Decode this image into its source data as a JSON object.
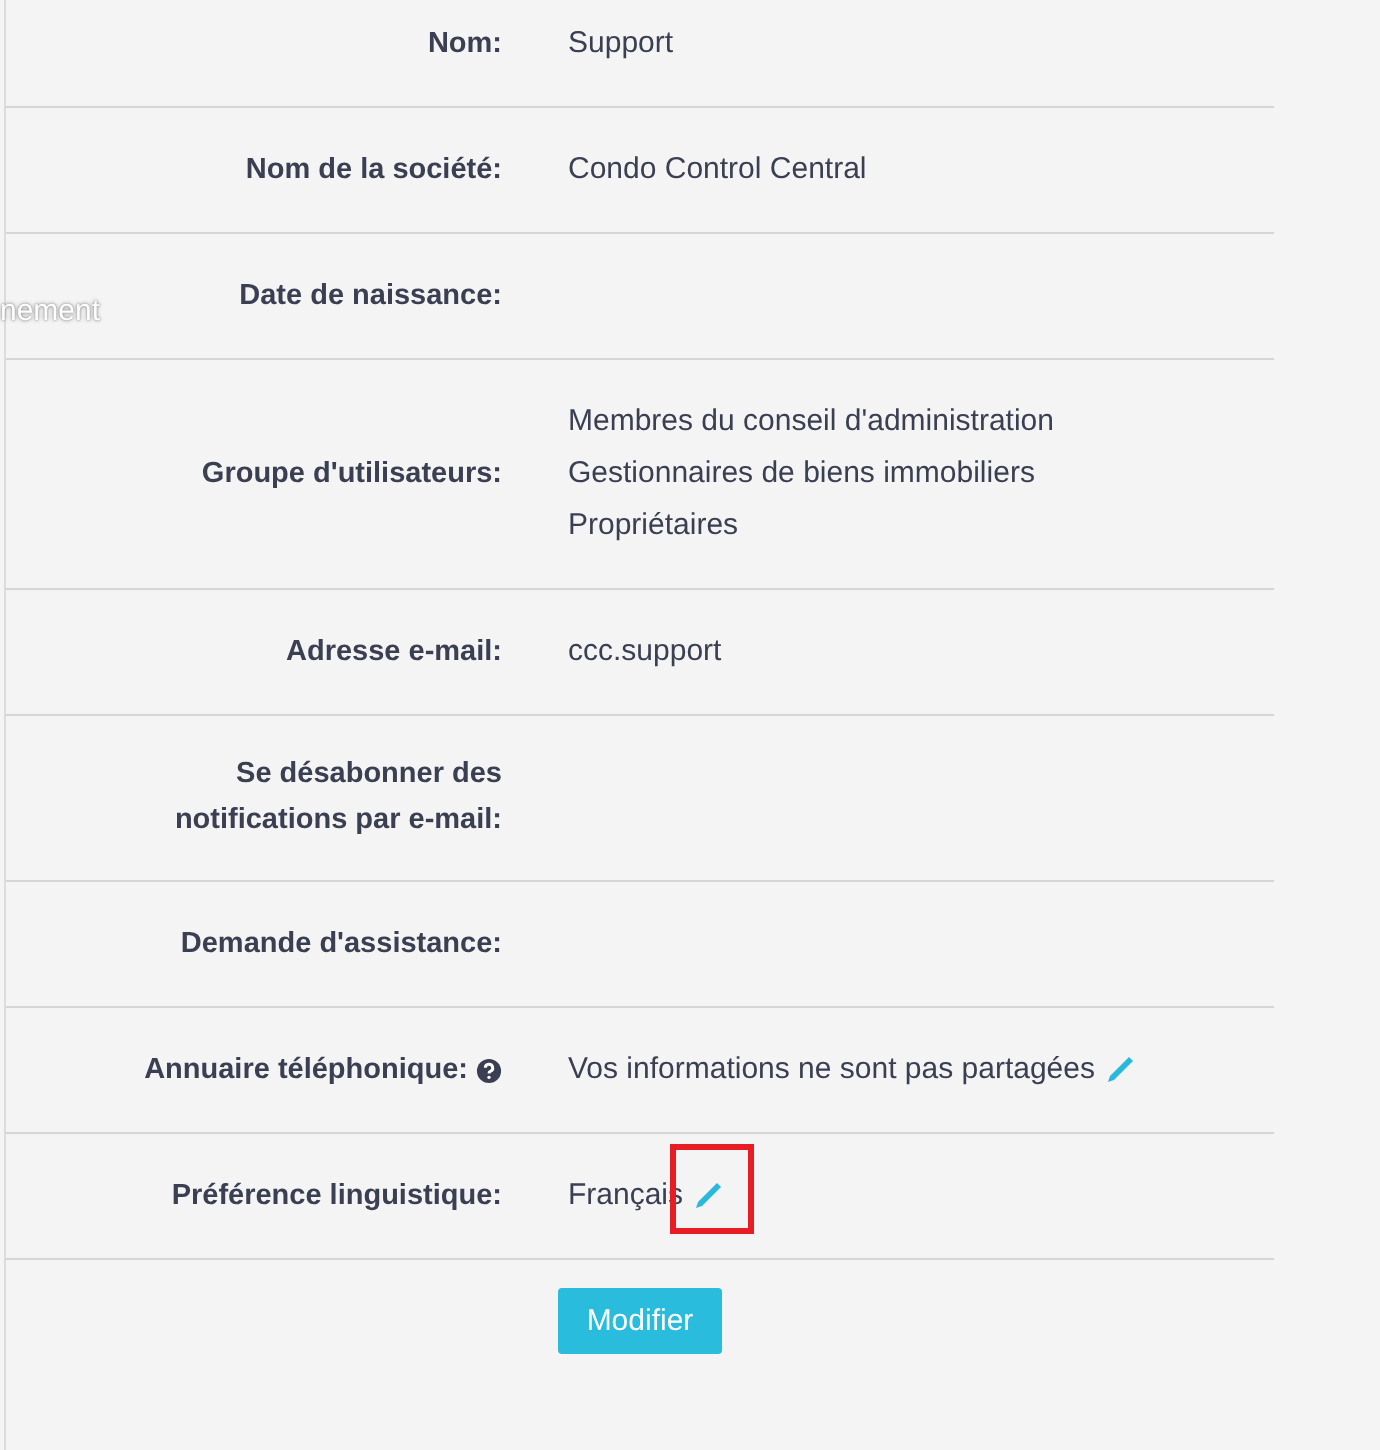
{
  "sidebar_fragment": "nement",
  "fields": [
    {
      "label": "Nom:",
      "values": [
        "Support"
      ]
    },
    {
      "label": "Nom de la société:",
      "values": [
        "Condo Control Central"
      ]
    },
    {
      "label": "Date de naissance:"
    },
    {
      "label": "Groupe d'utilisateurs:",
      "values": [
        "Membres du conseil d'administration",
        "Gestionnaires de biens immobiliers",
        "Propriétaires"
      ]
    },
    {
      "label": "Adresse e-mail:",
      "values": [
        "ccc.support"
      ]
    },
    {
      "label": "Se désabonner des notifications par e-mail:"
    },
    {
      "label": "Demande d'assistance:"
    },
    {
      "label": "Annuaire téléphonique:",
      "help": true,
      "values": [
        "Vos informations ne sont pas partagées"
      ],
      "editable": true
    },
    {
      "label": "Préférence linguistique:",
      "values": [
        "Français"
      ],
      "editable": true,
      "highlighted": true
    }
  ],
  "button": "Modifier"
}
